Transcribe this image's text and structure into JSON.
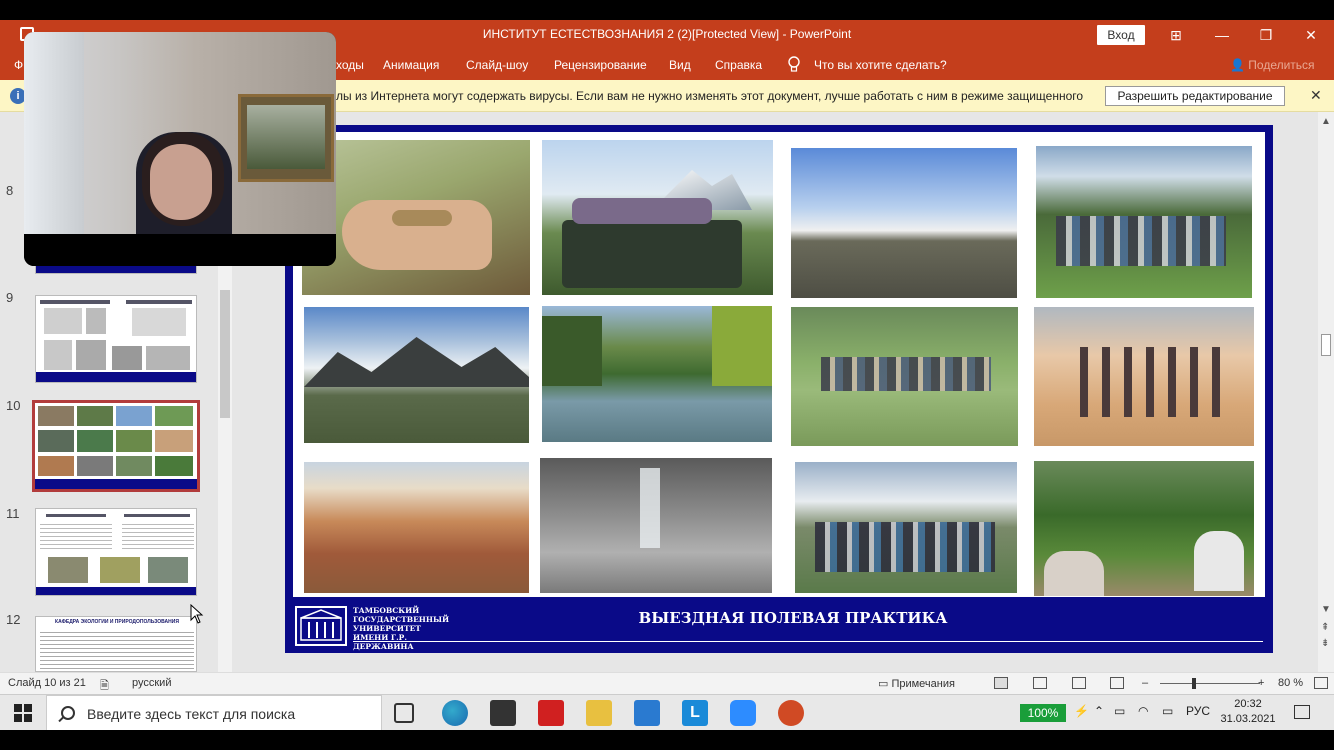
{
  "window": {
    "title": "ИНСТИТУТ ЕСТЕСТВОЗНАНИЯ 2 (2)[Protected View]  -  PowerPoint",
    "signin_label": "Вход"
  },
  "ribbon": {
    "tabs": [
      "Ф",
      "ходы",
      "Анимация",
      "Слайд-шоу",
      "Рецензирование",
      "Вид",
      "Справка"
    ],
    "tell_me": "Что вы хотите сделать?",
    "share": "Поделиться"
  },
  "protected_view": {
    "message": "лы из Интернета могут содержать вирусы. Если вам не нужно изменять этот документ, лучше работать с ним в режиме защищенного",
    "enable_label": "Разрешить редактирование"
  },
  "thumbnails": {
    "numbers": [
      "8",
      "9",
      "10",
      "11",
      "12"
    ],
    "slide12_heading": "КАФЕДРА ЭКОЛОГИИ И ПРИРОДОПОЛЬЗОВАНИЯ"
  },
  "slide": {
    "caption": "ВЫЕЗДНАЯ ПОЛЕВАЯ ПРАКТИКА",
    "university": "ТАМБОВСКИЙ ГОСУДАРСТВЕННЫЙ УНИВЕРСИТЕТ ИМЕНИ Г.Р. ДЕРЖАВИНА"
  },
  "status": {
    "slide_counter": "Слайд 10 из 21",
    "language": "русский",
    "notes_label": "Примечания",
    "zoom_minus": "–",
    "zoom_plus": "+",
    "zoom": "80 %"
  },
  "taskbar": {
    "search_placeholder": "Введите здесь текст для поиска",
    "battery": "100%",
    "lang": "РУС",
    "time": "20:32",
    "date": "31.03.2021"
  },
  "colors": {
    "ppt_red": "#c43e1c",
    "slide_blue": "#0a0a88",
    "selected_border": "#b23c3c"
  }
}
